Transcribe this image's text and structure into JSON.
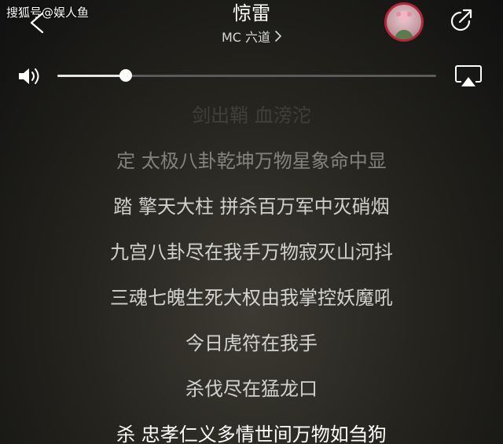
{
  "watermark": "搜狐号@娱人鱼",
  "header": {
    "title": "惊雷",
    "artist": "MC 六道",
    "back_icon": "chevron-left-icon",
    "share_icon": "share-icon",
    "avatar_icon": "artist-avatar"
  },
  "player": {
    "volume_icon": "volume-icon",
    "airplay_icon": "airplay-icon",
    "volume_level": 0.18
  },
  "lyrics": [
    "剑出鞘 血滂沱",
    "定 太极八卦乾坤万物星象命中显",
    "踏 擎天大柱 拼杀百万军中灭硝烟",
    "九宫八卦尽在我手万物寂灭山河抖",
    "三魂七魄生死大权由我掌控妖魔吼",
    "今日虎符在我手",
    "杀伐尽在猛龙口",
    "杀 忠孝仁义多情世间万物如刍狗"
  ],
  "colors": {
    "accent": "#b1263a"
  }
}
